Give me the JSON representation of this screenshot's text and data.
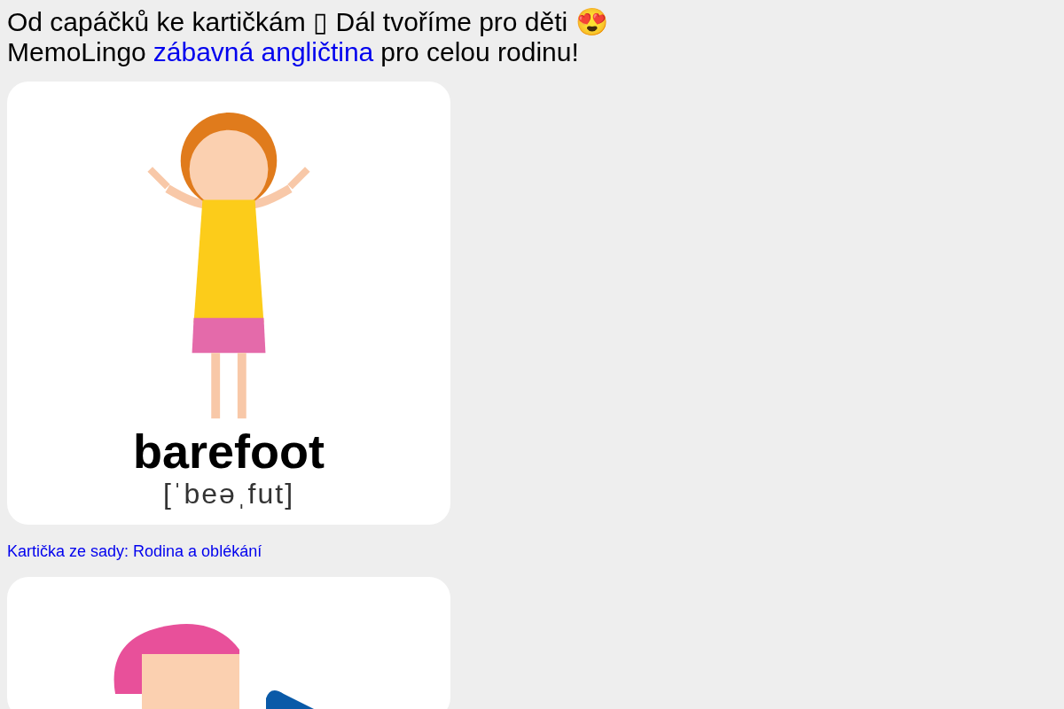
{
  "heading": {
    "line_1": "Od capáčků ke kartičkám ▯ Dál tvoříme pro děti 😍",
    "line_2_before": "MemoLingo",
    "line_2_link": "zábavná angličtina",
    "line_2_after": "pro celou rodinu!"
  },
  "cards": [
    {
      "word": "barefoot",
      "phonetic": "[ˈbeəˌfut]",
      "set_link": "Kartička ze sady: Rodina a oblékání"
    }
  ]
}
